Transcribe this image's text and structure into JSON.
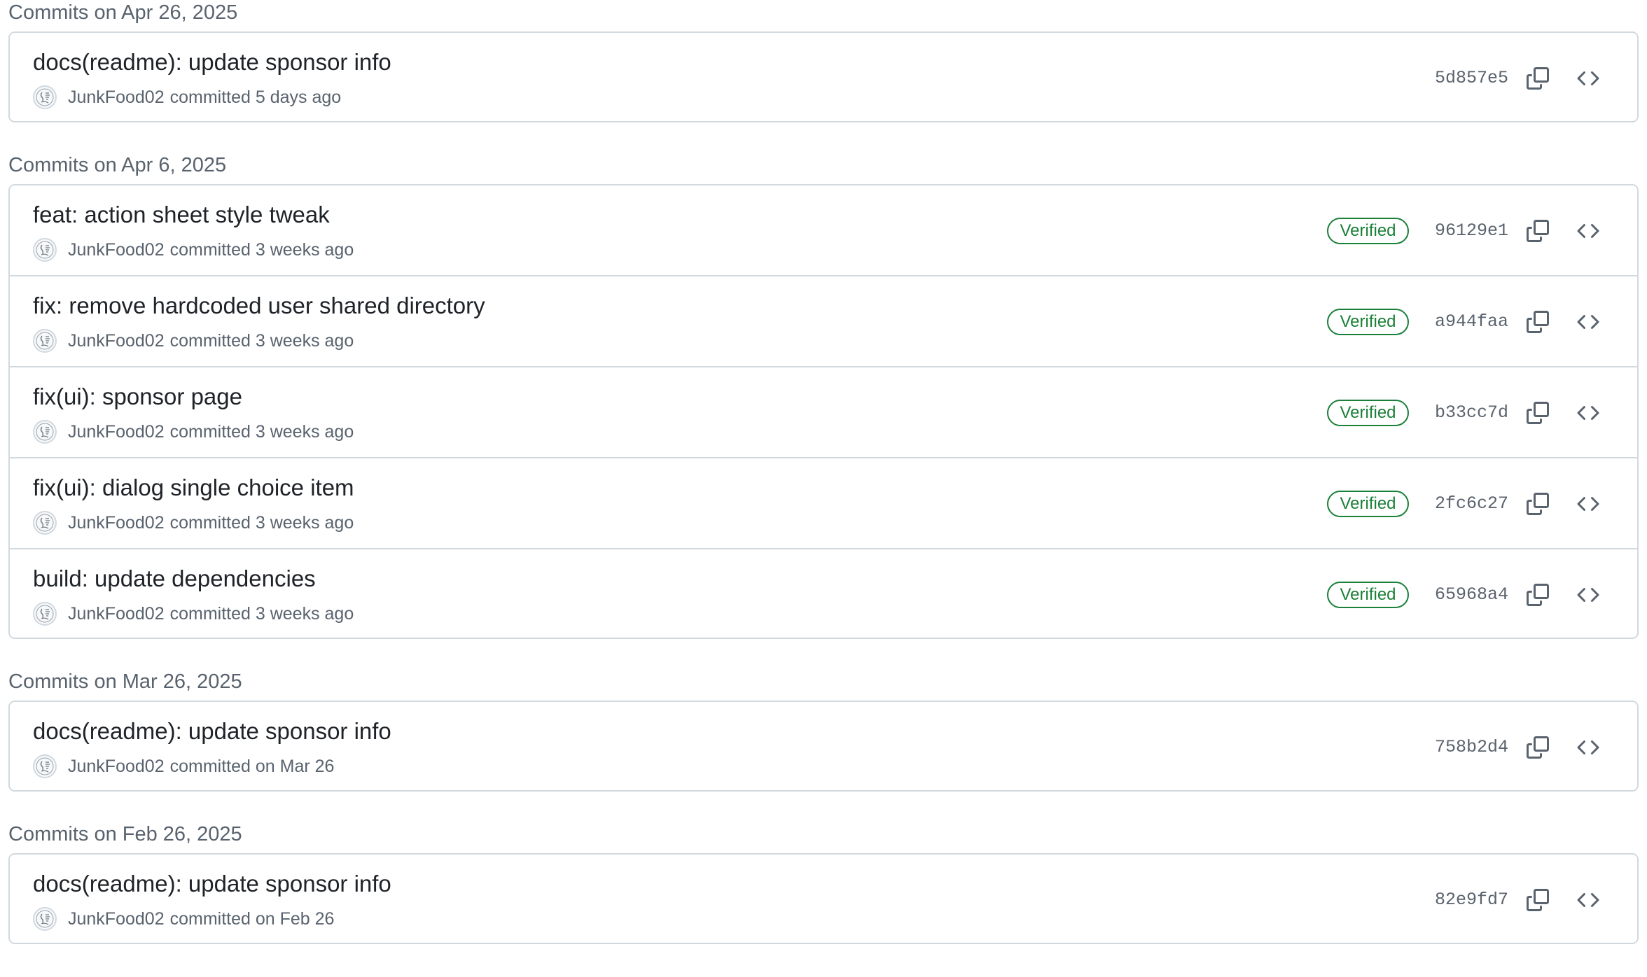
{
  "groups": [
    {
      "header": "Commits on Apr 26, 2025",
      "commits": [
        {
          "title": "docs(readme): update sponsor info",
          "author": "JunkFood02",
          "meta": "committed 5 days ago",
          "verified": "",
          "sha": "5d857e5"
        }
      ]
    },
    {
      "header": "Commits on Apr 6, 2025",
      "commits": [
        {
          "title": "feat: action sheet style tweak",
          "author": "JunkFood02",
          "meta": "committed 3 weeks ago",
          "verified": "Verified",
          "sha": "96129e1"
        },
        {
          "title": "fix: remove hardcoded user shared directory",
          "author": "JunkFood02",
          "meta": "committed 3 weeks ago",
          "verified": "Verified",
          "sha": "a944faa"
        },
        {
          "title": "fix(ui): sponsor page",
          "author": "JunkFood02",
          "meta": "committed 3 weeks ago",
          "verified": "Verified",
          "sha": "b33cc7d"
        },
        {
          "title": "fix(ui): dialog single choice item",
          "author": "JunkFood02",
          "meta": "committed 3 weeks ago",
          "verified": "Verified",
          "sha": "2fc6c27"
        },
        {
          "title": "build: update dependencies",
          "author": "JunkFood02",
          "meta": "committed 3 weeks ago",
          "verified": "Verified",
          "sha": "65968a4"
        }
      ]
    },
    {
      "header": "Commits on Mar 26, 2025",
      "commits": [
        {
          "title": "docs(readme): update sponsor info",
          "author": "JunkFood02",
          "meta": "committed on Mar 26",
          "verified": "",
          "sha": "758b2d4"
        }
      ]
    },
    {
      "header": "Commits on Feb 26, 2025",
      "commits": [
        {
          "title": "docs(readme): update sponsor info",
          "author": "JunkFood02",
          "meta": "committed on Feb 26",
          "verified": "",
          "sha": "82e9fd7"
        }
      ]
    }
  ],
  "icons": {
    "avatar": "avatar-image",
    "copy": "copy-icon",
    "browse": "code-icon"
  },
  "colors": {
    "verified": "#1a7f37",
    "border": "#d1d9e0",
    "muted": "#59636e",
    "text": "#1f2328"
  }
}
